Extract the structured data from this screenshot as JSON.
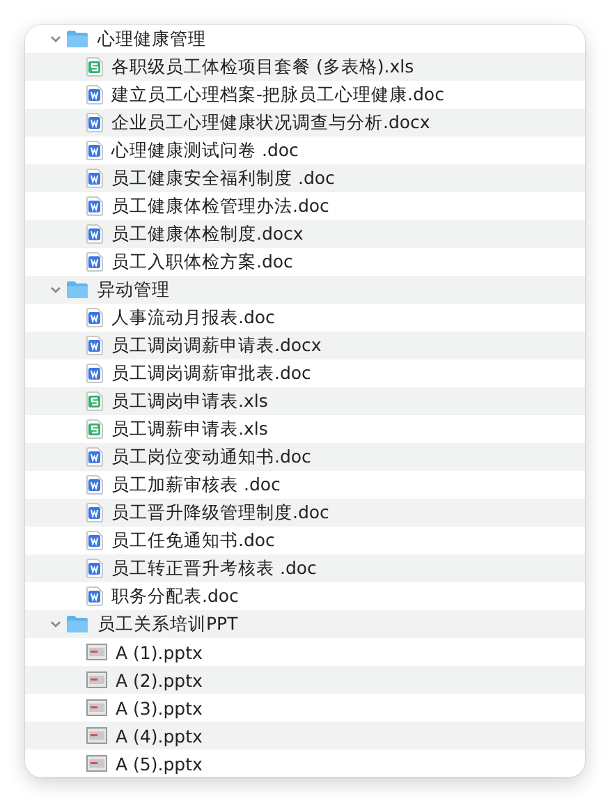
{
  "folders": [
    {
      "name": "心理健康管理",
      "expanded": true,
      "children": [
        {
          "name": "各职级员工体检项目套餐 (多表格).xls",
          "kind": "sheet"
        },
        {
          "name": "建立员工心理档案-把脉员工心理健康.doc",
          "kind": "word"
        },
        {
          "name": "企业员工心理健康状况调查与分析.docx",
          "kind": "word"
        },
        {
          "name": "心理健康测试问卷 .doc",
          "kind": "word"
        },
        {
          "name": "员工健康安全福利制度 .doc",
          "kind": "word"
        },
        {
          "name": "员工健康体检管理办法.doc",
          "kind": "word"
        },
        {
          "name": "员工健康体检制度.docx",
          "kind": "word"
        },
        {
          "name": "员工入职体检方案.doc",
          "kind": "word"
        }
      ]
    },
    {
      "name": "异动管理",
      "expanded": true,
      "children": [
        {
          "name": "人事流动月报表.doc",
          "kind": "word"
        },
        {
          "name": "员工调岗调薪申请表.docx",
          "kind": "word"
        },
        {
          "name": "员工调岗调薪审批表.doc",
          "kind": "word"
        },
        {
          "name": "员工调岗申请表.xls",
          "kind": "sheet"
        },
        {
          "name": "员工调薪申请表.xls",
          "kind": "sheet"
        },
        {
          "name": "员工岗位变动通知书.doc",
          "kind": "word"
        },
        {
          "name": "员工加薪审核表 .doc",
          "kind": "word"
        },
        {
          "name": "员工晋升降级管理制度.doc",
          "kind": "word"
        },
        {
          "name": "员工任免通知书.doc",
          "kind": "word"
        },
        {
          "name": "员工转正晋升考核表 .doc",
          "kind": "word"
        },
        {
          "name": "职务分配表.doc",
          "kind": "word"
        }
      ]
    },
    {
      "name": "员工关系培训PPT",
      "expanded": true,
      "children": [
        {
          "name": "A (1).pptx",
          "kind": "slides"
        },
        {
          "name": "A (2).pptx",
          "kind": "slides"
        },
        {
          "name": "A (3).pptx",
          "kind": "slides"
        },
        {
          "name": "A (4).pptx",
          "kind": "slides"
        },
        {
          "name": "A (5).pptx",
          "kind": "slides"
        }
      ]
    }
  ]
}
